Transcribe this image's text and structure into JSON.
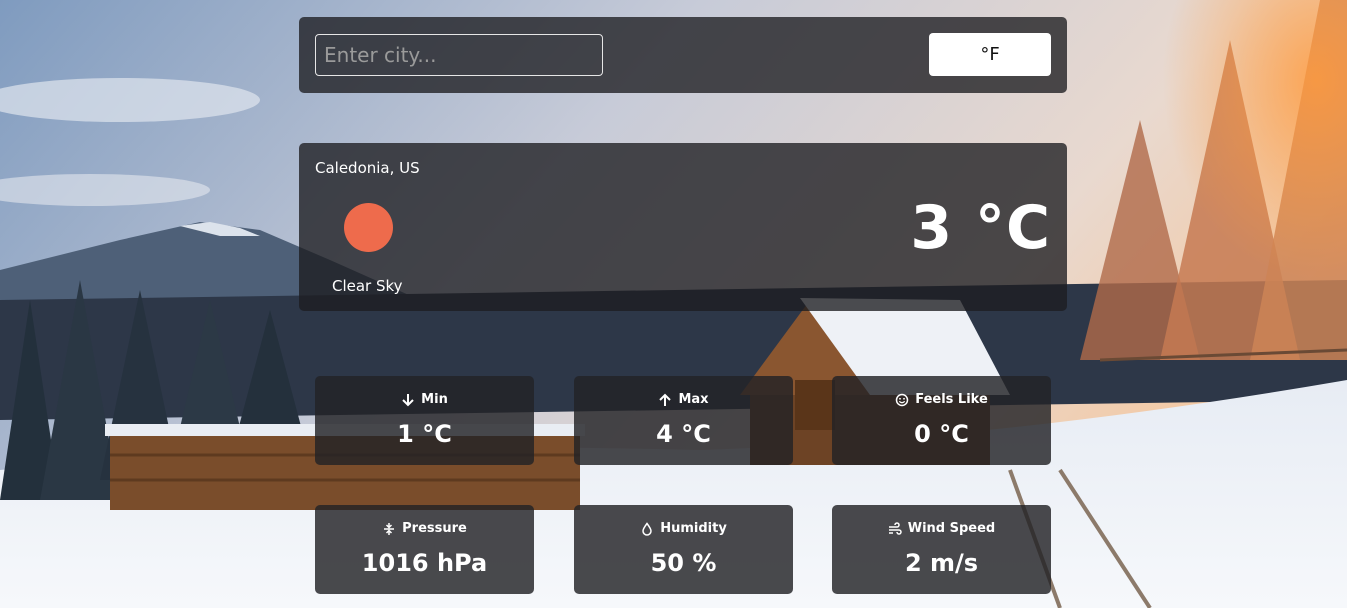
{
  "search": {
    "placeholder": "Enter city...",
    "value": ""
  },
  "unit_toggle": {
    "label": "°F"
  },
  "current": {
    "location": "Caledonia, US",
    "temperature": "3 °C",
    "condition": "Clear Sky",
    "icon": "sun-icon",
    "icon_color": "#ee6b4c"
  },
  "stats": {
    "min": {
      "label": "Min",
      "value": "1 °C",
      "icon": "arrow-down-icon"
    },
    "max": {
      "label": "Max",
      "value": "4 °C",
      "icon": "arrow-up-icon"
    },
    "feels_like": {
      "label": "Feels Like",
      "value": "0 °C",
      "icon": "smile-icon"
    },
    "pressure": {
      "label": "Pressure",
      "value": "1016 hPa",
      "icon": "pressure-icon"
    },
    "humidity": {
      "label": "Humidity",
      "value": "50 %",
      "icon": "droplet-icon"
    },
    "wind_speed": {
      "label": "Wind Speed",
      "value": "2 m/s",
      "icon": "wind-icon"
    }
  },
  "theme": {
    "panel_bg": "#1c1c20",
    "button_bg": "#ffffff",
    "text": "#ffffff"
  }
}
